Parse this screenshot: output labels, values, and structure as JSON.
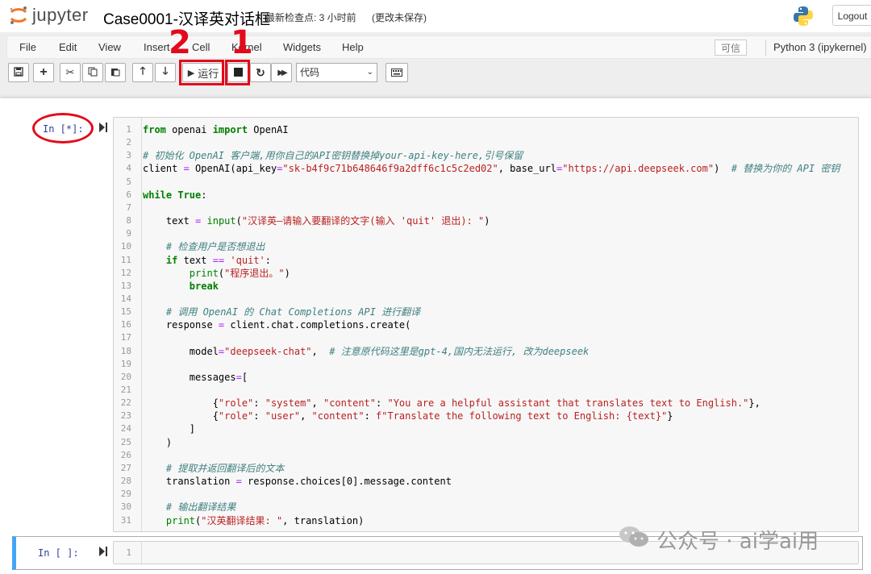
{
  "header": {
    "logo_text": "jupyter",
    "notebook_name": "Case0001-汉译英对话框",
    "checkpoint": "最新检查点: 3 小时前",
    "autosave": "(更改未保存)",
    "logout_label": "Logout"
  },
  "menu": {
    "items": [
      "File",
      "Edit",
      "View",
      "Insert",
      "Cell",
      "Kernel",
      "Widgets",
      "Help"
    ],
    "trusted_label": "可信",
    "kernel_name": "Python 3 (ipykernel)"
  },
  "toolbar": {
    "run_label": "运行",
    "cell_type": "代码"
  },
  "annotations": {
    "label_1": "1",
    "label_2": "2",
    "color": "#e30a1b"
  },
  "cells": [
    {
      "prompt": "In  [*]:",
      "lines": [
        "from openai import OpenAI",
        "",
        "# 初始化 OpenAI 客户端,用你自己的API密钥替换掉your-api-key-here,引号保留",
        "client = OpenAI(api_key=\"sk-b4f9c71b648646f9a2dff6c1c5c2ed02\", base_url=\"https://api.deepseek.com\")  # 替换为你的 API 密钥",
        "",
        "while True:",
        "",
        "    text = input(\"汉译英—请输入要翻译的文字(输入 'quit' 退出): \")",
        "",
        "    # 检查用户是否想退出",
        "    if text == 'quit':",
        "        print(\"程序退出。\")",
        "        break",
        "",
        "    # 调用 OpenAI 的 Chat Completions API 进行翻译",
        "    response = client.chat.completions.create(",
        "",
        "        model=\"deepseek-chat\",  # 注意原代码这里是gpt-4,国内无法运行, 改为deepseek",
        "",
        "        messages=[",
        "",
        "            {\"role\": \"system\", \"content\": \"You are a helpful assistant that translates text to English.\"},",
        "            {\"role\": \"user\", \"content\": f\"Translate the following text to English: {text}\"}",
        "        ]",
        "    )",
        "",
        "    # 提取并返回翻译后的文本",
        "    translation = response.choices[0].message.content",
        "",
        "    # 输出翻译结果",
        "    print(\"汉英翻译结果: \", translation)"
      ]
    },
    {
      "prompt": "In  [ ]:",
      "lines": [
        ""
      ]
    }
  ],
  "watermark": "公众号 · ai学ai用",
  "colors": {
    "selected_cell": "#42a5f5",
    "prompt_in": "#303f9f",
    "keyword": "#008000",
    "string": "#ba2121",
    "comment": "#408080"
  }
}
